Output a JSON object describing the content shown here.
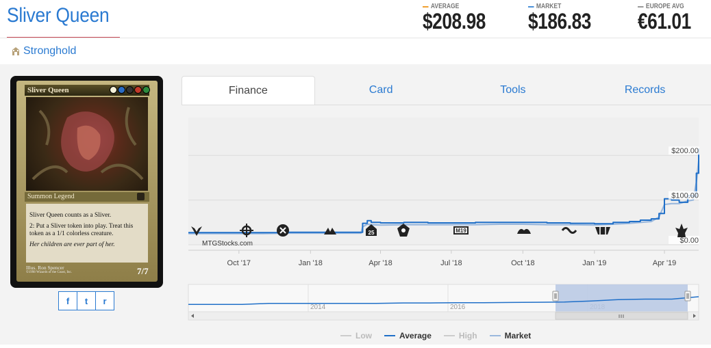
{
  "header": {
    "title": "Sliver Queen",
    "set_name": "Stronghold",
    "prices": [
      {
        "label": "AVERAGE",
        "value": "$208.98",
        "color": "#f0a030"
      },
      {
        "label": "MARKET",
        "value": "$186.83",
        "color": "#4a90d9"
      },
      {
        "label": "EUROPE AVG",
        "value": "€61.01",
        "color": "#999999"
      }
    ]
  },
  "card": {
    "name": "Sliver Queen",
    "type_line": "Summon Legend",
    "rules_1": "Sliver Queen counts as a Sliver.",
    "rules_2": "2: Put a Sliver token into play. Treat this token as a 1/1 colorless creature.",
    "flavor": "Her children are ever part of her.",
    "illustrator": "Illus. Ron Spencer",
    "copyright": "©1998 Wizards of the Coast, Inc.",
    "pt": "7/7",
    "mana_colors": [
      "#f5f1d9",
      "#2b6cc4",
      "#333333",
      "#c23a2a",
      "#2e8b3e"
    ]
  },
  "share": {
    "icons": [
      "facebook-icon",
      "twitter-icon",
      "reddit-icon"
    ],
    "glyphs": [
      "f",
      "t",
      "r"
    ]
  },
  "tabs": [
    {
      "label": "Finance",
      "active": true
    },
    {
      "label": "Card",
      "active": false
    },
    {
      "label": "Tools",
      "active": false
    },
    {
      "label": "Records",
      "active": false
    }
  ],
  "chart_data": {
    "type": "line",
    "watermark": "MTGStocks.com",
    "y_ticks": [
      "$200.00",
      "$100.00",
      "$0.00"
    ],
    "ylim": [
      0,
      260
    ],
    "x_ticks": [
      "Oct '17",
      "Jan '18",
      "Apr '18",
      "Jul '18",
      "Oct '18",
      "Jan '19",
      "Apr '19"
    ],
    "x": [
      "2017-07-28",
      "2017-08-10",
      "2017-09-01",
      "2017-10-01",
      "2017-11-01",
      "2017-12-01",
      "2018-01-01",
      "2018-02-01",
      "2018-03-07",
      "2018-03-09",
      "2018-03-15",
      "2018-03-20",
      "2018-04-01",
      "2018-05-01",
      "2018-06-01",
      "2018-07-01",
      "2018-08-01",
      "2018-09-01",
      "2018-10-01",
      "2018-11-01",
      "2018-12-01",
      "2019-01-01",
      "2019-01-25",
      "2019-02-15",
      "2019-03-01",
      "2019-03-15",
      "2019-03-25",
      "2019-04-01",
      "2019-04-10",
      "2019-04-20",
      "2019-05-01",
      "2019-05-08",
      "2019-05-12",
      "2019-05-15"
    ],
    "series": [
      {
        "name": "Average",
        "color": "#1f6fc8",
        "values": [
          27,
          27,
          27,
          27,
          27,
          28,
          28,
          28,
          28,
          48,
          54,
          50,
          49,
          50,
          49,
          49,
          50,
          50,
          50,
          49,
          48,
          47,
          50,
          52,
          55,
          58,
          70,
          103,
          100,
          95,
          110,
          108,
          160,
          215
        ]
      },
      {
        "name": "Market",
        "color": "#9ab8dd",
        "values": [
          25,
          25,
          25,
          25,
          25,
          26,
          26,
          26,
          26,
          40,
          46,
          45,
          44,
          45,
          45,
          45,
          45,
          46,
          46,
          45,
          45,
          44,
          46,
          48,
          50,
          52,
          62,
          90,
          92,
          92,
          98,
          100,
          140,
          187
        ]
      }
    ],
    "legend": [
      {
        "name": "Low",
        "color": "#cccccc"
      },
      {
        "name": "Average",
        "color": "#1f6fc8"
      },
      {
        "name": "High",
        "color": "#cccccc"
      },
      {
        "name": "Market",
        "color": "#9ab8dd"
      }
    ],
    "set_icons": [
      "hour-of-devastation-icon",
      "ixalan-icon",
      "rivals-of-ixalan-icon",
      "masters-25-icon",
      "dominaria-icon",
      "core-2019-icon",
      "guilds-of-ravnica-icon",
      "ultimate-masters-icon",
      "ravnica-allegiance-icon",
      "war-of-the-spark-icon"
    ],
    "navigator": {
      "year_labels": [
        "2014",
        "2016",
        "2018"
      ],
      "values": [
        8,
        8,
        8,
        12,
        12,
        12,
        12,
        12,
        14,
        14,
        15,
        15,
        16,
        17,
        18,
        22,
        28,
        30,
        30,
        40
      ]
    }
  }
}
